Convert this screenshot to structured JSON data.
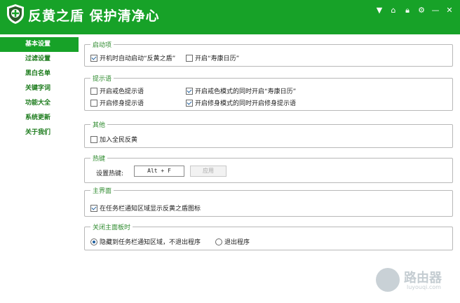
{
  "window": {
    "title": "反黄之盾  保护清净心",
    "controls": [
      "arrow-down-icon",
      "home-icon",
      "lock-icon",
      "gear-icon",
      "minimize-icon",
      "close-icon"
    ],
    "accent": "#17a228"
  },
  "sidebar": {
    "items": [
      {
        "label": "基本设置",
        "active": true
      },
      {
        "label": "过滤设置"
      },
      {
        "label": "黑白名单"
      },
      {
        "label": "关键字词"
      },
      {
        "label": "功能大全"
      },
      {
        "label": "系统更新"
      },
      {
        "label": "关于我们"
      }
    ]
  },
  "groups": {
    "startup": {
      "title": "启动项",
      "options": [
        {
          "label": "开机时自动启动“反黄之盾”",
          "checked": true
        },
        {
          "label": "开启“寿康日历”",
          "checked": false
        }
      ]
    },
    "tips": {
      "title": "提示语",
      "options": [
        {
          "label": "开启戒色提示语",
          "checked": false
        },
        {
          "label": "开启戒色模式的同时开启“寿康日历”",
          "checked": true
        },
        {
          "label": "开启修身提示语",
          "checked": false
        },
        {
          "label": "开启修身模式的同时开启修身提示语",
          "checked": true
        }
      ]
    },
    "other": {
      "title": "其他",
      "options": [
        {
          "label": "加入全民反黄",
          "checked": false
        }
      ]
    },
    "hotkey": {
      "title": "热键",
      "label": "设置热键:",
      "value": "Alt + F",
      "apply": "应用"
    },
    "mainui": {
      "title": "主界面",
      "options": [
        {
          "label": "在任务栏通知区域显示反黄之盾图标",
          "checked": true
        }
      ]
    },
    "close": {
      "title": "关闭主面板时",
      "options": [
        {
          "label": "隐藏到任务栏通知区域，不退出程序",
          "checked": true
        },
        {
          "label": "退出程序",
          "checked": false
        }
      ]
    }
  },
  "watermark": {
    "text": "路由器",
    "url": "luyouqi.com"
  }
}
